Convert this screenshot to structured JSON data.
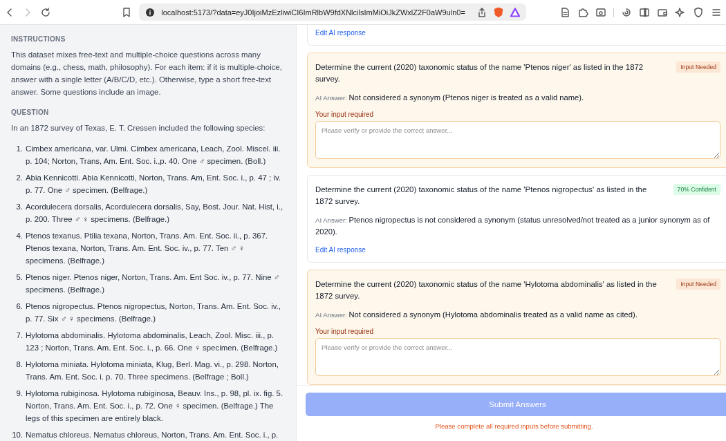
{
  "browser": {
    "url": "localhost:5173/?data=eyJ0IjoiMzEzliwiCI6ImRlbW9fdXNlcilsImMiOiJkZWxlZ2F0aW9uln0="
  },
  "instructions": {
    "heading": "INSTRUCTIONS",
    "text": "This dataset mixes free-text and multiple-choice questions across many domains (e.g., chess, math, philosophy). For each item: if it is multiple-choice, answer with a single letter (A/B/C/D, etc.). Otherwise, type a short free-text answer. Some questions include an image."
  },
  "question": {
    "heading": "QUESTION",
    "intro": "In an 1872 survey of Texas, E. T. Cressen included the following species:",
    "items": [
      {
        "number": "1.",
        "text": "Cimbex americana, var. Ulmi. Cimbex americana, Leach, Zool. Miscel. iii. p. 104; Norton, Trans, Am. Ent. Soc. i.,p. 40. One ♂ specimen. (Boll.)"
      },
      {
        "number": "2.",
        "text": "Abia Kennicotti. Abia Kennicotti, Norton, Trans. Am, Ent. Soc. i., p. 47 ; iv. p. 77. One ♂ specimen. (Belfrage.)"
      },
      {
        "number": "3.",
        "text": "Acordulecera dorsalis, Acordulecera dorsalis, Say, Bost. Jour. Nat. Hist, i., p. 200. Three ♂ ♀ specimens. (Belfrage.)"
      },
      {
        "number": "4.",
        "text": "Ptenos texanus. Ptilia texana, Norton, Trans. Am. Ent. Soc. ii., p. 367. Ptenos texana, Norton, Trans. Am. Ent. Soc. iv., p. 77. Ten ♂ ♀ specimens. (Belfrage.)"
      },
      {
        "number": "5.",
        "text": "Ptenos niger. Ptenos niger, Norton, Trans. Am. Ent Soc. iv., p. 77. Nine ♂ specimens. (Belfrage.)"
      },
      {
        "number": "6.",
        "text": "Ptenos nigropectus. Ptenos nigropectus, Norton, Trans. Am. Ent. Soc. iv., p. 77. Six ♂ ♀ specimens. (Belfrage.)"
      },
      {
        "number": "7.",
        "text": "Hylotoma abdominalis. Hylotoma abdominalis, Leach, Zool. Misc. iii., p. 123 ; Norton, Trans. Am. Ent. Soc. i., p. 66. One ♀ specimen. (Belfrage.)"
      },
      {
        "number": "8.",
        "text": "Hylotoma miniata. Hylotoma miniata, Klug, Berl. Mag. vi., p. 298. Norton, Trans. Am. Ent. Soc. i. p. 70. Three specimens. (Belfrage ; Boll.)"
      },
      {
        "number": "9.",
        "text": "Hylotoma rubiginosa. Hylotoma rubiginosa, Beauv. Ins., p. 98, pl. ix. fig. 5. Norton, Trans. Am. Ent. Soc. i., p. 72. One ♀ specimen. (Belfrage.) The legs of this specimen are entirely black."
      },
      {
        "number": "10.",
        "text": "Nematus chloreus. Nematus chloreus, Norton, Trans. Am. Ent. Soc. i., p."
      }
    ]
  },
  "cards": [
    {
      "kind": "confident",
      "edit_link": "Edit AI response"
    },
    {
      "kind": "input",
      "question": "Determine the current (2020) taxonomic status of the name 'Ptenos niger' as listed in the 1872 survey.",
      "badge": "Input Needed",
      "ai_label": "AI Answer:",
      "ai_answer": "Not considered a synonym (Ptenos niger is treated as a valid name).",
      "input_label": "Your input required",
      "placeholder": "Please verify or provide the correct answer..."
    },
    {
      "kind": "confident",
      "question": "Determine the current (2020) taxonomic status of the name 'Ptenos nigropectus' as listed in the 1872 survey.",
      "badge": "70% Confident",
      "ai_label": "AI Answer:",
      "ai_answer": "Ptenos nigropectus is not considered a synonym (status unresolved/not treated as a junior synonym as of 2020).",
      "edit_link": "Edit AI response"
    },
    {
      "kind": "input",
      "question": "Determine the current (2020) taxonomic status of the name 'Hylotoma abdominalis' as listed in the 1872 survey.",
      "badge": "Input Needed",
      "ai_label": "AI Answer:",
      "ai_answer": "Not considered a synonym (Hylotoma abdominalis treated as a valid name as cited).",
      "input_label": "Your input required",
      "placeholder": "Please verify or provide the correct answer..."
    }
  ],
  "submit": {
    "label": "Submit Answers",
    "disabled": true,
    "message": "Please complete all required inputs before submitting."
  }
}
